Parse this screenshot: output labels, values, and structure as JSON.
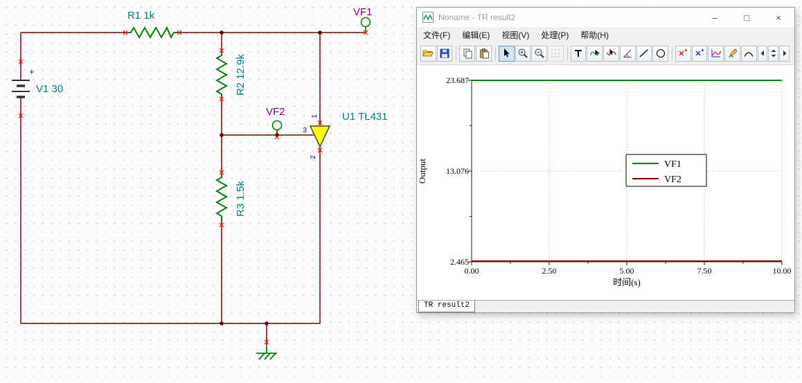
{
  "schematic": {
    "labels": {
      "v1": "V1 30",
      "plus": "+",
      "r1": "R1 1k",
      "r2": "R2 12.9k",
      "r3": "R3 1.5k",
      "u1": "U1 TL431",
      "vf1": "VF1",
      "vf2": "VF2",
      "pin1": "1",
      "pin2": "2",
      "pin3": "3"
    },
    "colors": {
      "wire": "#7a0000",
      "component_green": "#008000",
      "ref_label": "#007d7d",
      "probe_label": "#800080",
      "pin_number": "#0000cc",
      "terminal_cross": "#ff0000",
      "tl431_fill": "#ffff00"
    }
  },
  "window": {
    "title": "Noname - TR result2",
    "menu": [
      "文件(F)",
      "编辑(E)",
      "视图(V)",
      "处理(P)",
      "帮助(H)"
    ],
    "controls": {
      "minimize": "–",
      "maximize": "□",
      "close": "×"
    },
    "toolbar": [
      "open",
      "save",
      "copy",
      "paste",
      "select",
      "zoom-in",
      "zoom-100",
      "grid",
      "text",
      "cursor-a",
      "cursor-b",
      "slope",
      "line",
      "ellipse",
      "marker-a",
      "marker-b",
      "axes",
      "pencil",
      "interpolate",
      "prev-page",
      "page-scroll",
      "next-page"
    ],
    "tab": "TR result2"
  },
  "chart_data": {
    "type": "line",
    "title": "",
    "xlabel": "时间(s)",
    "ylabel": "Output",
    "xlim": [
      0,
      10
    ],
    "ylim": [
      2.465,
      23.687
    ],
    "xticks": [
      "0.00",
      "2.50",
      "5.00",
      "7.50",
      "10.00"
    ],
    "yticks": [
      "23.687",
      "13.076",
      "2.465"
    ],
    "grid": "dotted",
    "legend_position": "center-right",
    "series": [
      {
        "name": "VF1",
        "color": "#008000",
        "x": [
          0,
          10
        ],
        "y": [
          23.687,
          23.687
        ]
      },
      {
        "name": "VF2",
        "color": "#7b0101",
        "x": [
          0,
          10
        ],
        "y": [
          2.465,
          2.465
        ]
      }
    ]
  }
}
